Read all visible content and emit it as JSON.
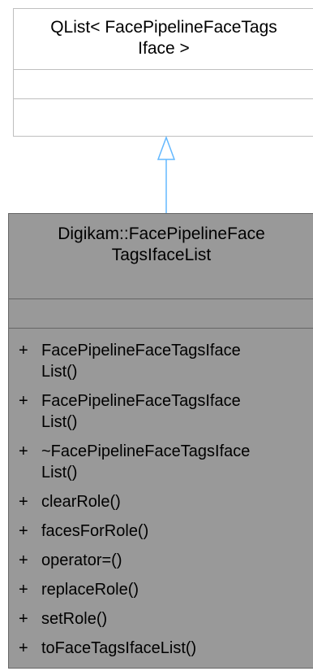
{
  "base_class": {
    "title": "QList< FacePipelineFaceTags\nIface >"
  },
  "derived_class": {
    "title": "Digikam::FacePipelineFace\nTagsIfaceList",
    "methods": [
      {
        "visibility": "+",
        "name": "FacePipelineFaceTagsIface\nList()"
      },
      {
        "visibility": "+",
        "name": "FacePipelineFaceTagsIface\nList()"
      },
      {
        "visibility": "+",
        "name": "~FacePipelineFaceTagsIface\nList()"
      },
      {
        "visibility": "+",
        "name": "clearRole()"
      },
      {
        "visibility": "+",
        "name": "facesForRole()"
      },
      {
        "visibility": "+",
        "name": "operator=()"
      },
      {
        "visibility": "+",
        "name": "replaceRole()"
      },
      {
        "visibility": "+",
        "name": "setRole()"
      },
      {
        "visibility": "+",
        "name": "toFaceTagsIfaceList()"
      }
    ]
  },
  "colors": {
    "arrow": "#63b8ff",
    "derived_fill": "#999999",
    "base_fill": "#ffffff",
    "border": "#bfbfbf"
  },
  "icons": {
    "inheritance": "hollow-triangle-arrow"
  }
}
